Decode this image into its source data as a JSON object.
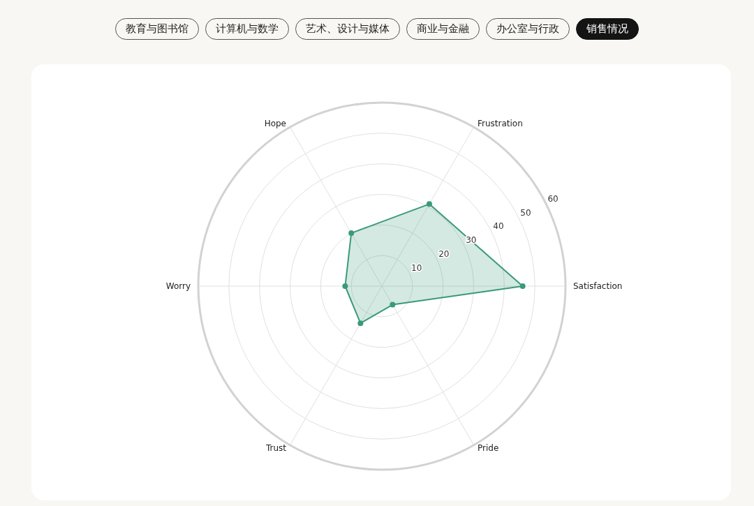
{
  "tabs": [
    {
      "label": "教育与图书馆",
      "selected": false
    },
    {
      "label": "计算机与数学",
      "selected": false
    },
    {
      "label": "艺术、设计与媒体",
      "selected": false
    },
    {
      "label": "商业与金融",
      "selected": false
    },
    {
      "label": "办公室与行政",
      "selected": false
    },
    {
      "label": "销售情况",
      "selected": true
    }
  ],
  "chart": {
    "chart_data": {
      "type": "radar",
      "categories": [
        "Frustration",
        "Satisfaction",
        "Pride",
        "Trust",
        "Worry",
        "Hope"
      ],
      "values": [
        31,
        46,
        7,
        14,
        12,
        20
      ],
      "ylim": [
        0,
        60
      ],
      "yticks": [
        10,
        20,
        30,
        40,
        50,
        60
      ]
    }
  }
}
